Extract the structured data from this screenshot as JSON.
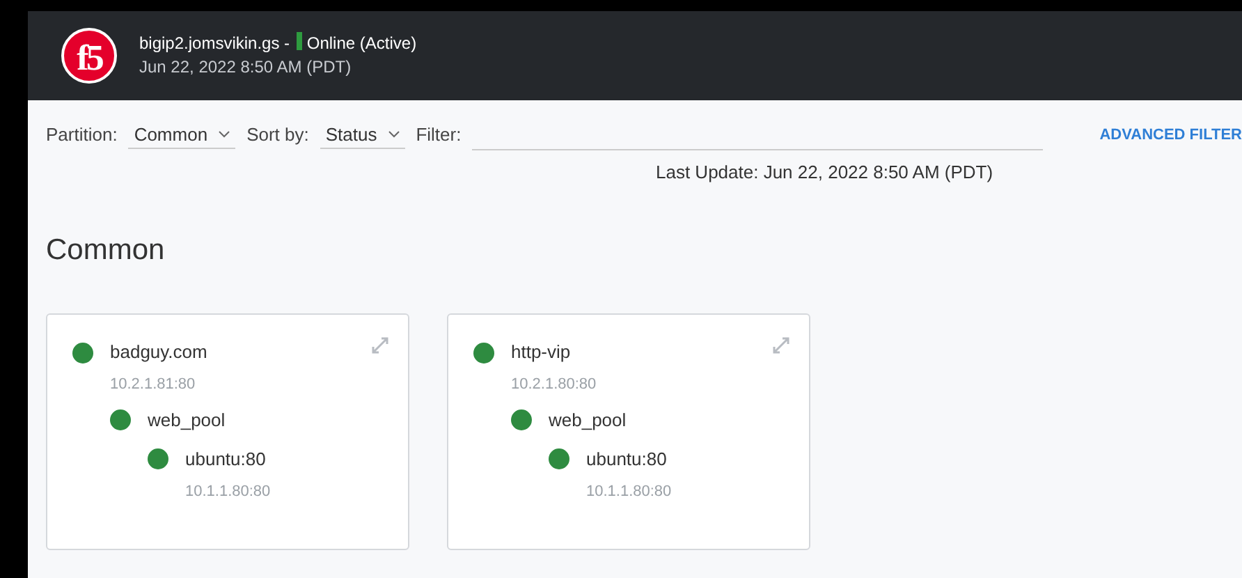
{
  "header": {
    "logo": "f5",
    "device": "bigip2.jomsvikin.gs -",
    "status": {
      "color": "#2e9b3f",
      "text": "Online (Active)"
    },
    "timestamp": "Jun 22, 2022 8:50 AM (PDT)"
  },
  "toolbar": {
    "partition_label": "Partition:",
    "partition": "Common",
    "sort_label": "Sort by:",
    "sort": "Status",
    "filter_label": "Filter:",
    "advanced": "ADVANCED FILTER",
    "last_update": "Last Update: Jun 22, 2022 8:50 AM (PDT)"
  },
  "section_title": "Common",
  "cards": [
    {
      "name": "badguy.com",
      "address": "10.2.1.81:80",
      "color": "#2e8b40",
      "children": [
        {
          "name": "web_pool",
          "color": "#2e8b40",
          "children": [
            {
              "name": "ubuntu:80",
              "address": "10.1.1.80:80",
              "color": "#2e8b40"
            }
          ]
        }
      ]
    },
    {
      "name": "http-vip",
      "address": "10.2.1.80:80",
      "color": "#2e8b40",
      "children": [
        {
          "name": "web_pool",
          "color": "#2e8b40",
          "children": [
            {
              "name": "ubuntu:80",
              "address": "10.1.1.80:80",
              "color": "#2e8b40"
            }
          ]
        }
      ]
    }
  ]
}
